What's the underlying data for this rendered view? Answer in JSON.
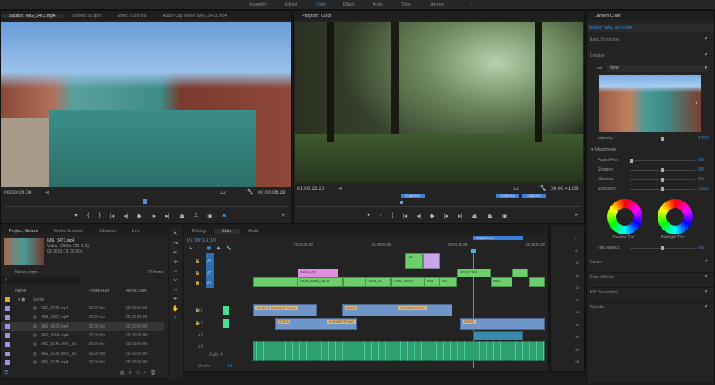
{
  "workspaces": [
    "Assembly",
    "Editing",
    "Color",
    "Effects",
    "Audio",
    "Titles",
    "Libraries"
  ],
  "active_workspace": "Color",
  "source": {
    "tabs": [
      "Source: IMG_3473.mp4",
      "Lumetri Scopes",
      "Effect Controls",
      "Audio Clip Mixer: IMG_3473.mp4"
    ],
    "timecode": "00:00:03:08",
    "fit": "Fit",
    "resolution": "1/2",
    "duration": "00:00:06:19"
  },
  "program": {
    "tab": "Program: Color",
    "timecode": "01:00:13:10",
    "fit": "Fit",
    "resolution": "1/2",
    "duration": "00:00:41:09",
    "markers": [
      "Captions",
      "Captions",
      "Captions"
    ]
  },
  "lumetri": {
    "tab": "Lumetri Color",
    "clip": "Master * IMG_3473.mp4",
    "basic": "Basic Correction",
    "creative": "Creative",
    "look_label": "Look",
    "look_value": "None",
    "intensity_label": "Intensity",
    "intensity": "100.0",
    "adjustments": "Adjustments",
    "sliders": [
      {
        "label": "Faded Film",
        "value": "0.0",
        "pos": 0
      },
      {
        "label": "Sharpen",
        "value": "0.0",
        "pos": 0.5
      },
      {
        "label": "Vibrance",
        "value": "0.0",
        "pos": 0.5
      },
      {
        "label": "Saturation",
        "value": "100.0",
        "pos": 0.5
      }
    ],
    "shadow_tint": "Shadow Tint",
    "highlight_tint": "Highlight Tint",
    "tint_balance": "Tint Balance",
    "tint_balance_value": "0.0",
    "sections": [
      "Curves",
      "Color Wheels",
      "HSL Secondary",
      "Vignette"
    ]
  },
  "project": {
    "tabs": [
      "Project: Nature",
      "Media Browser",
      "Libraries",
      "Info"
    ],
    "clip_name": "IMG_3473.mp4",
    "clip_info": "Video, 1280 x 720 (1.0)",
    "clip_dur": "00:00:06:19, 30.00p",
    "project_file": "Nature.prproj",
    "item_count": "21 Items",
    "columns": [
      "Name",
      "Frame Rate",
      "Media Start"
    ],
    "folder": "Seeds",
    "rows": [
      {
        "name": "IMG_2273.mp4",
        "fps": "30.00 fps",
        "start": "00:00:00:00"
      },
      {
        "name": "IMG_3367.mp4",
        "fps": "30.00 fps",
        "start": "00:00:00:00"
      },
      {
        "name": "IMG_3473.mp4",
        "fps": "30.00 fps",
        "start": "00:00:00:00"
      },
      {
        "name": "IMG_3504.mp4",
        "fps": "30.00 fps",
        "start": "00:00:00:00"
      },
      {
        "name": "IMG_3575.MOV_01",
        "fps": "30.00 fps",
        "start": "00:00:00:00"
      },
      {
        "name": "IMG_3575.MOV_02",
        "fps": "30.00 fps",
        "start": "00:00:00:00"
      },
      {
        "name": "IMG_3575.mp4",
        "fps": "30.00 fps",
        "start": "00:00:00:00"
      }
    ]
  },
  "timeline": {
    "tabs": [
      "Editing",
      "Color",
      "Audio"
    ],
    "timecode": "01:00:13:10",
    "ruler": [
      "01:00:01:09",
      "01:00:06:09",
      "01:00:11:09",
      "01:00:16:09"
    ],
    "caption_marker": "Captions 1",
    "tracks": {
      "v3": "V3",
      "v2": "V2",
      "v1": "V1",
      "a1": "A1",
      "a2": "A2",
      "a3": "A3",
      "a4": "A4",
      "audio4": "Audio 4",
      "master": "Master",
      "master_val": "0.0"
    },
    "clips": {
      "v3a": "A0",
      "v2a": "Saber_03",
      "v2b": "A0IJ_C262",
      "v2c": "",
      "v1a": "A003_C028_0610",
      "v1b": "A001_C",
      "v1c": "A002_C267",
      "v1d": "C02",
      "v1e": "C0",
      "v1f": "D04",
      "cross": "Cross",
      "cp": "Constant Power"
    }
  },
  "meter_ticks": [
    "0",
    "-6",
    "-12",
    "-18",
    "-24",
    "-30",
    "-36",
    "-42",
    "-48",
    "-54",
    "-dB"
  ]
}
